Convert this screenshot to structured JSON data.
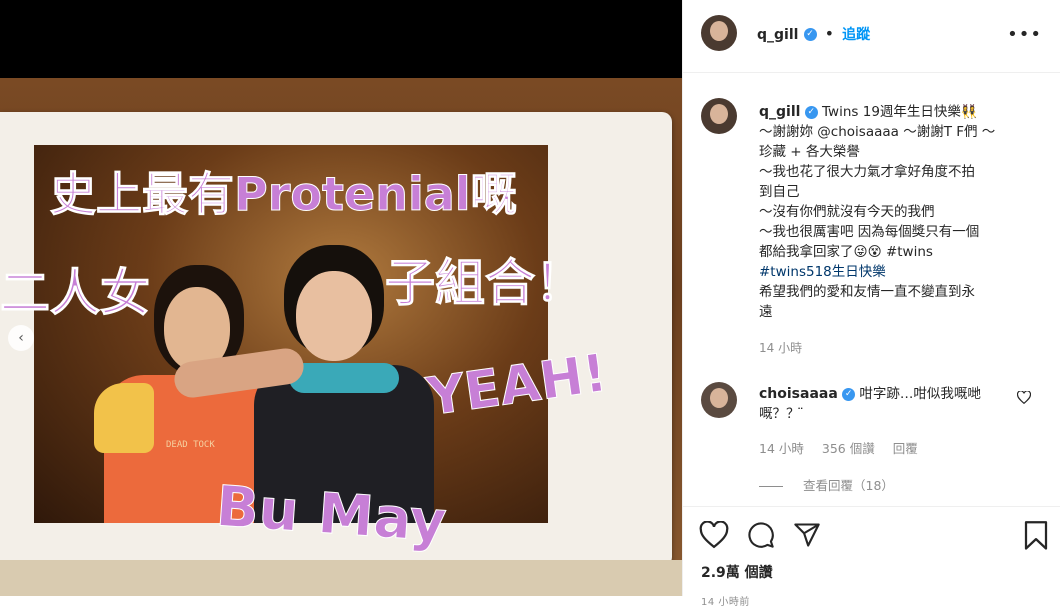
{
  "post": {
    "username": "q_gill",
    "follow_label": "追蹤",
    "more_icon": "more-options-icon"
  },
  "caption": {
    "username": "q_gill",
    "lines": [
      "Twins 19週年生日快樂👯‍♀️",
      "～謝謝妳 @choisaaaa ～謝謝T F們 ～",
      "珍藏 + 各大榮譽",
      "～我也花了很大力氣才拿好角度不拍",
      "到自己",
      "～沒有你們就沒有今天的我們",
      "～我也很厲害吧 因為每個獎只有一個",
      "都給我拿回家了😜😵 #twins",
      "#twins518生日快樂",
      "希望我們的愛和友情一直不變直到永",
      "遠"
    ],
    "time": "14 小時"
  },
  "comment": {
    "username": "choisaaaa",
    "text_line1": "咁字跡…咁似我嘅哋",
    "text_line2": "嘅？？ ̈",
    "time": "14 小時",
    "likes": "356 個讚",
    "reply": "回覆",
    "view_replies": "查看回覆（18）"
  },
  "stats": {
    "likes": "2.9萬 個讚",
    "ago": "14 小時前"
  },
  "photo": {
    "scrawl_line1": "史上最有Protenial嘅",
    "scrawl_line2": "二人女",
    "scrawl_line3": "子組合！",
    "scrawl_line4": "YEAH!",
    "scrawl_line5": "Bu May",
    "shirt_text": "DEAD TOCK"
  },
  "colors": {
    "accent": "#0095f6",
    "verified": "#3897f0",
    "ink": "#c77fd6"
  }
}
